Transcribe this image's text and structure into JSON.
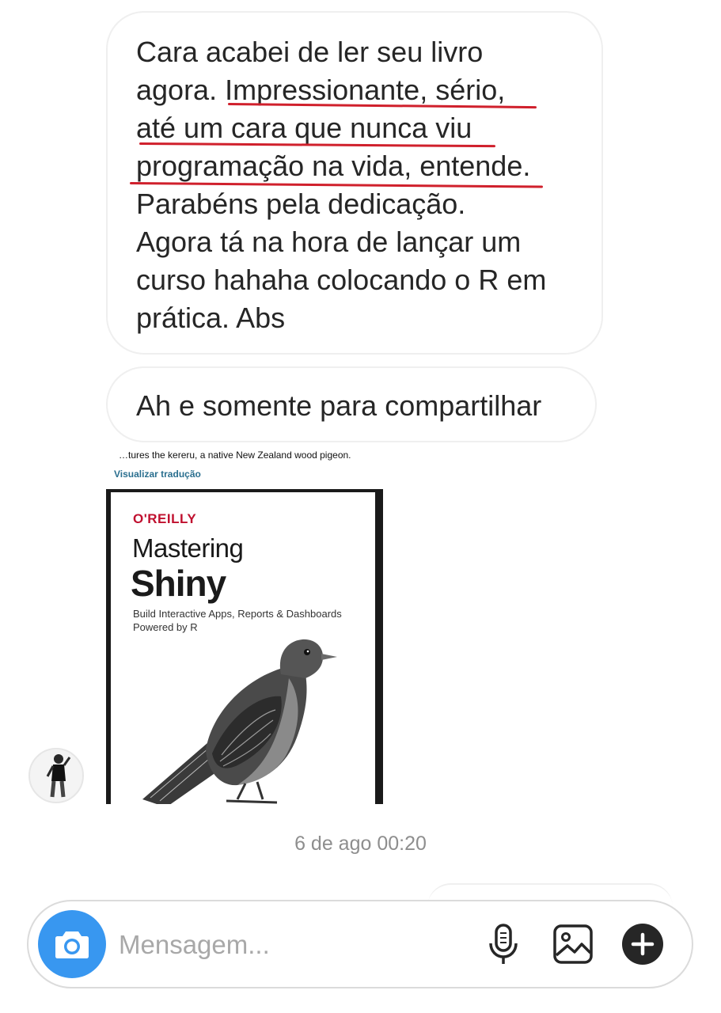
{
  "messages": [
    {
      "lines": [
        "Cara acabei de ler seu livro",
        "agora. Impressionante, sério,",
        "até um cara que nunca viu",
        "programação na vida, entende.",
        "Parabéns pela dedicação.",
        "Agora tá na hora de lançar um",
        "curso hahaha colocando o R em",
        "prática. Abs"
      ]
    },
    {
      "text": "Ah e somente para compartilhar"
    }
  ],
  "shared_post": {
    "caption": "…tures the kereru, a native New Zealand wood pigeon.",
    "translate_link": "Visualizar tradução",
    "book": {
      "publisher": "O'REILLY",
      "title_line1": "Mastering",
      "title_line2": "Shiny",
      "subtitle_line1": "Build Interactive Apps, Reports & Dashboards",
      "subtitle_line2": "Powered by R"
    }
  },
  "timestamp": "6 de ago 00:20",
  "composer": {
    "placeholder": "Mensagem...",
    "icons": [
      "camera-icon",
      "microphone-icon",
      "gallery-icon",
      "plus-icon"
    ]
  },
  "colors": {
    "underline": "#d0202c",
    "camera_button": "#3897f0",
    "publisher": "#c0102f",
    "translate_link": "#2a6f8f"
  }
}
